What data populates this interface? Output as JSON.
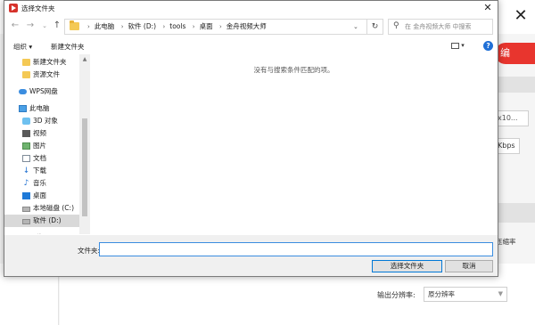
{
  "background": {
    "red_button_text": "编",
    "field1_value": "x10...",
    "field2_value": "Kbps",
    "compress_label": "压缩率",
    "resolution_label": "输出分辨率:",
    "resolution_value": "原分辨率"
  },
  "dialog": {
    "title": "选择文件夹",
    "breadcrumb": [
      "此电脑",
      "软件 (D:)",
      "tools",
      "桌面",
      "金舟视频大师"
    ],
    "search_placeholder": "在 金舟视频大师 中搜索",
    "toolbar": {
      "organize_label": "组织 ▾",
      "new_folder_label": "新建文件夹"
    },
    "nav_items": [
      {
        "label": "新建文件夹",
        "icon": "folder-icon"
      },
      {
        "label": "资源文件",
        "icon": "folder-icon"
      },
      {
        "label": "WPS网盘",
        "icon": "cloud-icon"
      },
      {
        "label": "此电脑",
        "icon": "computer-icon"
      },
      {
        "label": "3D 对象",
        "icon": "3d-objects-icon"
      },
      {
        "label": "视频",
        "icon": "video-icon"
      },
      {
        "label": "图片",
        "icon": "pictures-icon"
      },
      {
        "label": "文档",
        "icon": "documents-icon"
      },
      {
        "label": "下载",
        "icon": "download-icon"
      },
      {
        "label": "音乐",
        "icon": "music-icon"
      },
      {
        "label": "桌面",
        "icon": "desktop-icon"
      },
      {
        "label": "本地磁盘 (C:)",
        "icon": "drive-icon"
      },
      {
        "label": "软件 (D:)",
        "icon": "drive-icon",
        "selected": true
      },
      {
        "label": "网络",
        "icon": "network-icon"
      }
    ],
    "empty_message": "没有与搜索条件匹配的项。",
    "folder_label": "文件夹:",
    "folder_value": "",
    "select_button": "选择文件夹",
    "cancel_button": "取消",
    "accent_color": "#0078d7"
  }
}
